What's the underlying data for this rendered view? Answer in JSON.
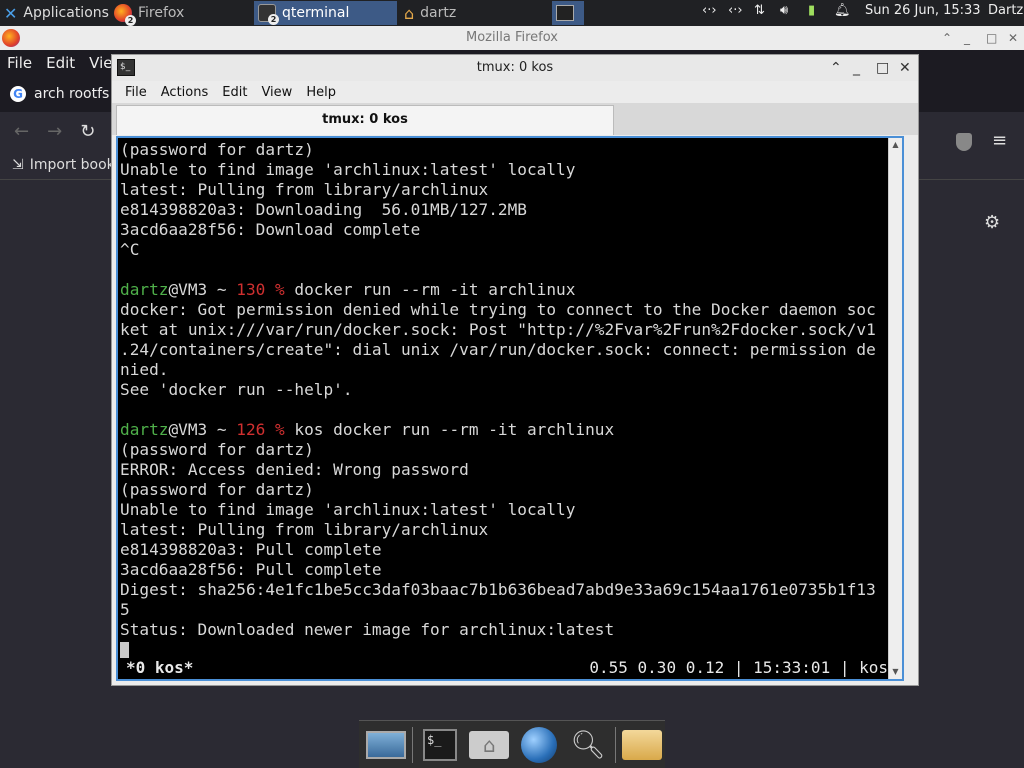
{
  "top_panel": {
    "applications_label": "Applications",
    "firefox_label": "Firefox",
    "firefox_count": "2",
    "qterminal_label": "qterminal",
    "qterminal_count": "2",
    "files_label": "dartz",
    "clock": "Sun 26 Jun, 15:33",
    "user": "Dartz"
  },
  "firefox": {
    "title": "Mozilla Firefox",
    "menu": [
      "File",
      "Edit",
      "View"
    ],
    "tab_label": "arch rootfs",
    "bookmark_label": "Import book"
  },
  "qterminal": {
    "title": "tmux: 0 kos",
    "menu": [
      "File",
      "Actions",
      "Edit",
      "View",
      "Help"
    ],
    "tab_label": "tmux: 0 kos"
  },
  "terminal": {
    "lines": [
      {
        "text": "(password for dartz)"
      },
      {
        "text": "Unable to find image 'archlinux:latest' locally"
      },
      {
        "text": "latest: Pulling from library/archlinux"
      },
      {
        "text": "e814398820a3: Downloading  56.01MB/127.2MB"
      },
      {
        "text": "3acd6aa28f56: Download complete"
      },
      {
        "text": "^C"
      },
      {
        "text": ""
      },
      {
        "prompt_user": "dartz",
        "prompt_rest": "@VM3 ~ ",
        "code": "130 %",
        "text": " docker run --rm -it archlinux"
      },
      {
        "text": "docker: Got permission denied while trying to connect to the Docker daemon soc"
      },
      {
        "text": "ket at unix:///var/run/docker.sock: Post \"http://%2Fvar%2Frun%2Fdocker.sock/v1"
      },
      {
        "text": ".24/containers/create\": dial unix /var/run/docker.sock: connect: permission de"
      },
      {
        "text": "nied."
      },
      {
        "text": "See 'docker run --help'."
      },
      {
        "text": ""
      },
      {
        "prompt_user": "dartz",
        "prompt_rest": "@VM3 ~ ",
        "code": "126 %",
        "text": " kos docker run --rm -it archlinux"
      },
      {
        "text": "(password for dartz)"
      },
      {
        "text": "ERROR: Access denied: Wrong password"
      },
      {
        "text": "(password for dartz)"
      },
      {
        "text": "Unable to find image 'archlinux:latest' locally"
      },
      {
        "text": "latest: Pulling from library/archlinux"
      },
      {
        "text": "e814398820a3: Pull complete"
      },
      {
        "text": "3acd6aa28f56: Pull complete"
      },
      {
        "text": "Digest: sha256:4e1fc1be5cc3daf03baac7b1b636bead7abd9e33a69c154aa1761e0735b1f13"
      },
      {
        "text": "5"
      },
      {
        "text": "Status: Downloaded newer image for archlinux:latest"
      }
    ],
    "status_left": "*0 kos*",
    "status_right": "0.55 0.30 0.12 | 15:33:01 | kos"
  },
  "dock": {
    "items": [
      "desktop-icon",
      "terminal-icon",
      "home-folder-icon",
      "web-browser-icon",
      "search-icon",
      "folder-icon"
    ]
  },
  "colors": {
    "prompt_user": "#4fb04a",
    "prompt_code": "#d03030",
    "active_border": "#4a8fd6"
  }
}
